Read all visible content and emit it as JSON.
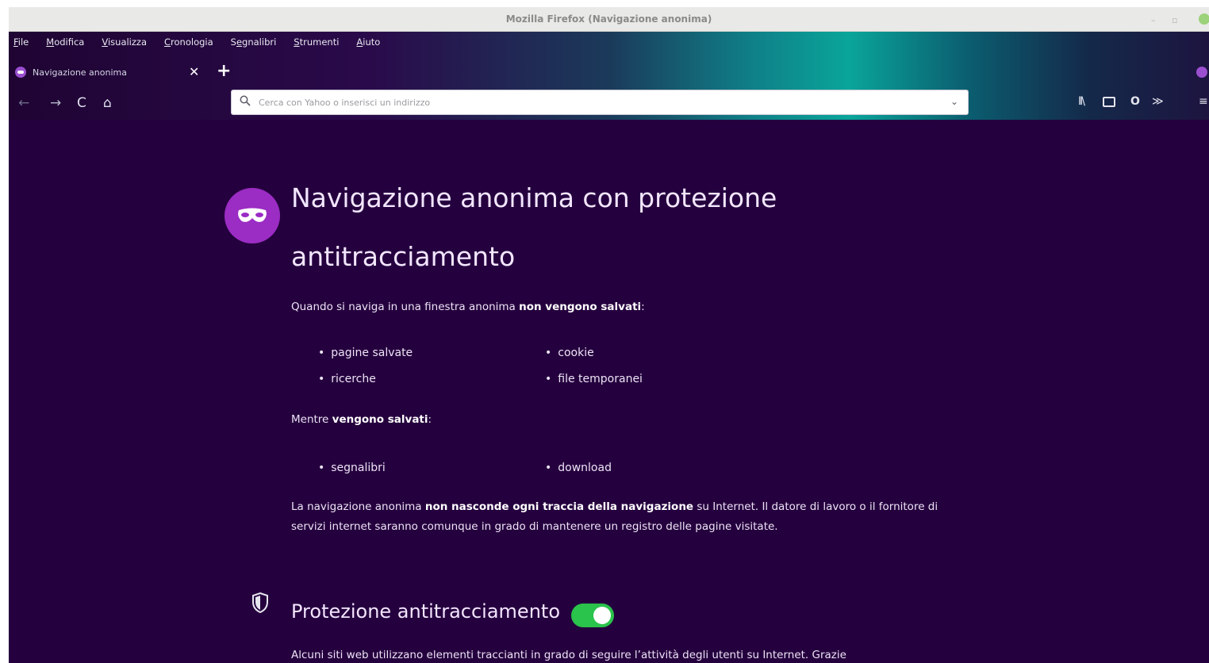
{
  "window": {
    "title": "Mozilla Firefox (Navigazione anonima)",
    "controls": [
      "minimize-icon",
      "maximize-icon",
      "close-icon"
    ]
  },
  "menubar": {
    "items": [
      {
        "pre": "",
        "u": "F",
        "post": "ile"
      },
      {
        "pre": "",
        "u": "M",
        "post": "odifica"
      },
      {
        "pre": "",
        "u": "V",
        "post": "isualizza"
      },
      {
        "pre": "",
        "u": "C",
        "post": "ronologia"
      },
      {
        "pre": "S",
        "u": "e",
        "post": "gnalibri"
      },
      {
        "pre": "",
        "u": "S",
        "post": "trumenti"
      },
      {
        "pre": "",
        "u": "A",
        "post": "iuto"
      }
    ]
  },
  "tab": {
    "label": "Navigazione anonima",
    "close_glyph": "✕",
    "new_tab_glyph": "+"
  },
  "navbar": {
    "back_glyph": "←",
    "forward_glyph": "→",
    "reload_glyph": "C",
    "home_glyph": "⌂",
    "url_placeholder": "Cerca con Yahoo o inserisci un indirizzo",
    "dropdown_glyph": "⌄",
    "library_glyph": "II\\",
    "vpn_glyph": "O",
    "extension_glyph": "≫",
    "menu_glyph": "≡"
  },
  "page": {
    "heading_line1": "Navigazione anonima con protezione",
    "heading_line2": "antitracciamento",
    "intro_pre": "Quando si naviga in una finestra anonima ",
    "intro_bold": "non vengono salvati",
    "intro_post": ":",
    "not_saved": [
      "pagine salvate",
      "cookie",
      "ricerche",
      "file temporanei"
    ],
    "saved_pre": "Mentre ",
    "saved_bold": "vengono salvati",
    "saved_post": ":",
    "saved": [
      "segnalibri",
      "download"
    ],
    "warning_pre": "La navigazione anonima ",
    "warning_bold": "non nasconde ogni traccia della navigazione",
    "warning_post": " su Internet. Il datore di lavoro o il fornitore di servizi internet saranno comunque in grado di mantenere un registro delle pagine visitate.",
    "tracking_title": "Protezione antitracciamento",
    "tracking_enabled": true,
    "tracking_desc": "Alcuni siti web utilizzano elementi traccianti in grado di seguire l’attività degli utenti su Internet. Grazie"
  },
  "colors": {
    "content_bg": "#25003e",
    "mask_circle": "#9b2cc4",
    "toggle_on": "#2ac34b"
  }
}
